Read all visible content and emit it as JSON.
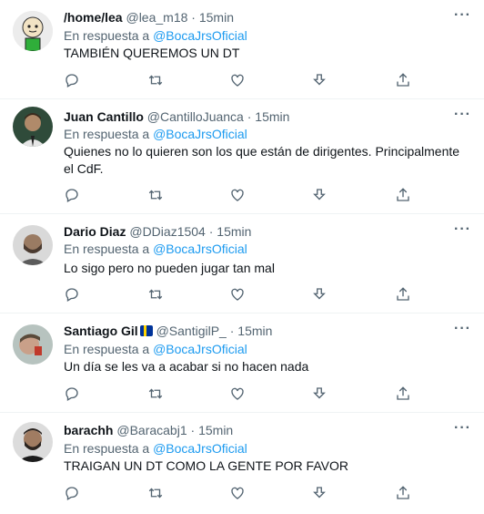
{
  "reply_prefix": "En respuesta a",
  "tweets": [
    {
      "name": "/home/lea",
      "handle": "@lea_m18",
      "separator": "·",
      "time": "15min",
      "reply_to": "@BocaJrsOficial",
      "text": "TAMBIÉN QUEREMOS UN DT",
      "avatar": "cartoon-avatar"
    },
    {
      "name": "Juan Cantillo",
      "handle": "@CantilloJuanca",
      "separator": "·",
      "time": "15min",
      "reply_to": "@BocaJrsOficial",
      "text": "Quienes no lo quieren son los que están de dirigentes. Principalmente el CdF.",
      "avatar": "photo-avatar"
    },
    {
      "name": "Dario Diaz",
      "handle": "@DDiaz1504",
      "separator": "·",
      "time": "15min",
      "reply_to": "@BocaJrsOficial",
      "text": "Lo sigo pero no pueden jugar tan mal",
      "avatar": "photo-avatar"
    },
    {
      "name": "Santiago Gil",
      "handle": "@SantigilP_",
      "separator": "·",
      "time": "15min",
      "reply_to": "@BocaJrsOficial",
      "text": "Un día se les va a acabar si no hacen nada",
      "avatar": "photo-avatar",
      "badge": "flag-emoji"
    },
    {
      "name": "barachh",
      "handle": "@Baracabj1",
      "separator": "·",
      "time": "15min",
      "reply_to": "@BocaJrsOficial",
      "text": "TRAIGAN UN DT COMO LA GENTE POR FAVOR",
      "avatar": "photo-avatar"
    }
  ],
  "colors": {
    "link": "#1d9bf0",
    "secondary": "#536471",
    "primary": "#0f1419",
    "divider": "#eff3f4"
  },
  "icons": [
    "reply-icon",
    "retweet-icon",
    "like-icon",
    "download-icon",
    "share-icon",
    "more-icon"
  ]
}
